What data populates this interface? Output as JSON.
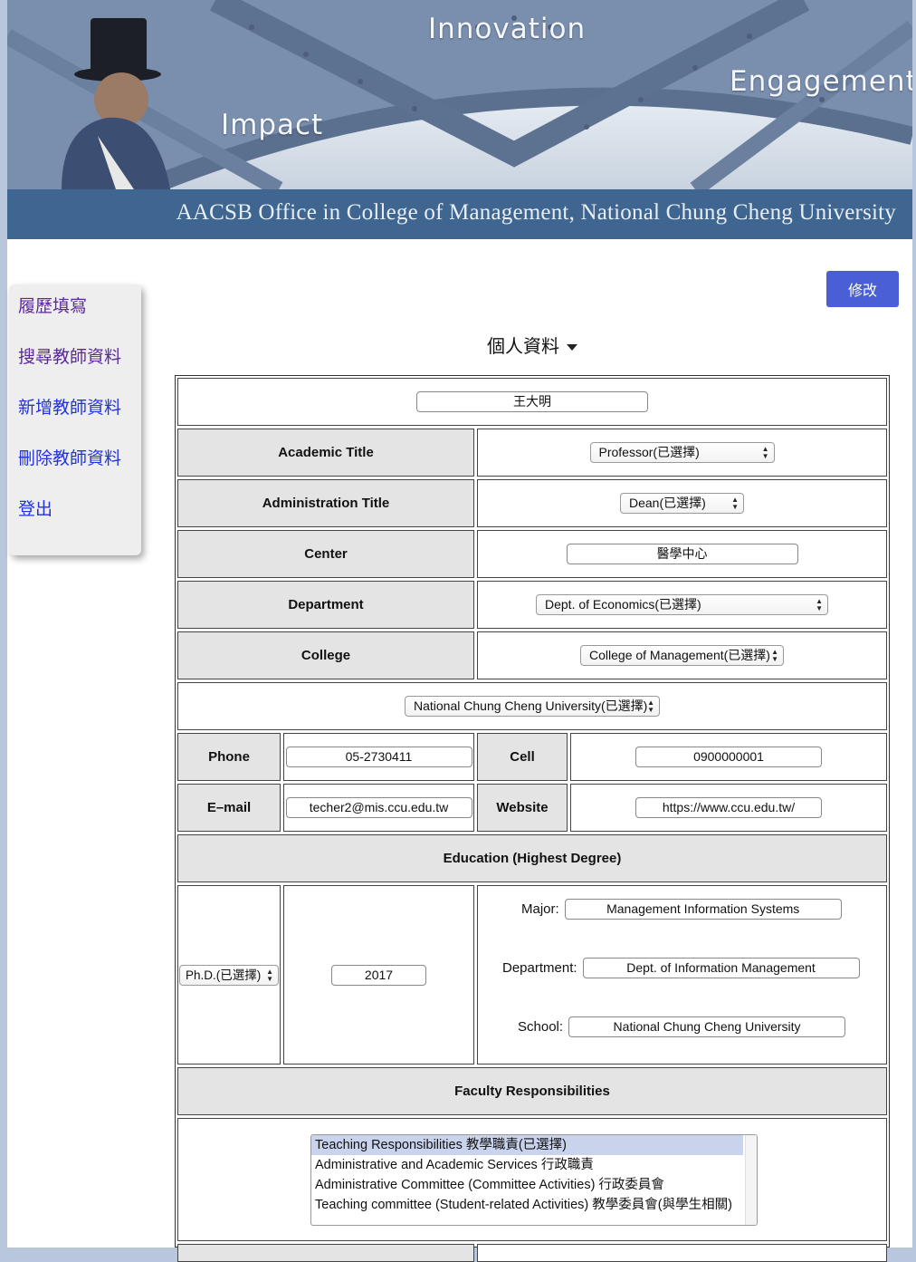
{
  "banner": {
    "words": [
      "Innovation",
      "Engagement",
      "Impact"
    ],
    "caption": "AACSB Office in College of Management, National Chung Cheng University"
  },
  "sidebar": {
    "items": [
      {
        "label": "履歷填寫",
        "state": "visited"
      },
      {
        "label": "搜尋教師資料",
        "state": "visited"
      },
      {
        "label": "新增教師資料",
        "state": "normal"
      },
      {
        "label": "刪除教師資料",
        "state": "normal"
      },
      {
        "label": "登出",
        "state": "normal"
      }
    ]
  },
  "toolbar": {
    "edit_label": "修改"
  },
  "section": {
    "title": "個人資料"
  },
  "form": {
    "name": "王大明",
    "academic_title": {
      "label": "Academic Title",
      "value": "Professor(已選擇)"
    },
    "administration_title": {
      "label": "Administration Title",
      "value": "Dean(已選擇)"
    },
    "center": {
      "label": "Center",
      "value": "醫學中心"
    },
    "department": {
      "label": "Department",
      "value": "Dept. of Economics(已選擇)"
    },
    "college": {
      "label": "College",
      "value": "College of Management(已選擇)"
    },
    "university": "National Chung Cheng University(已選擇)",
    "phone": {
      "label": "Phone",
      "value": "05-2730411"
    },
    "cell": {
      "label": "Cell",
      "value": "0900000001"
    },
    "email": {
      "label": "E–mail",
      "value": "techer2@mis.ccu.edu.tw"
    },
    "website": {
      "label": "Website",
      "value": "https://www.ccu.edu.tw/"
    },
    "education": {
      "header": "Education (Highest Degree)",
      "degree": "Ph.D.(已選擇)",
      "year": "2017",
      "major_label": "Major:",
      "major": "Management Information Systems",
      "department_label": "Department:",
      "department": "Dept. of Information Management",
      "school_label": "School:",
      "school": "National Chung Cheng University"
    },
    "responsibilities": {
      "header": "Faculty Responsibilities",
      "options": [
        "Teaching Responsibilities 教學職責(已選擇)",
        "Administrative and Academic Services 行政職責",
        "Administrative Committee (Committee Activities) 行政委員會",
        "Teaching committee (Student-related Activities) 教學委員會(與學生相關)"
      ],
      "selected_index": 0
    }
  },
  "colors": {
    "banner_bar": "#3f6690",
    "edit_button": "#4a5fd6",
    "visited_link": "#5b2a9a",
    "link": "#2233dd",
    "header_cell": "#e4e4e4"
  }
}
